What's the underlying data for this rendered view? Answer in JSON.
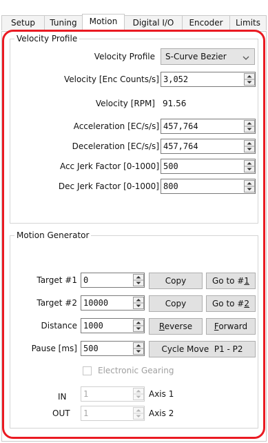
{
  "tabs": [
    {
      "label": "Setup"
    },
    {
      "label": "Tuning"
    },
    {
      "label": "Motion",
      "active": true
    },
    {
      "label": "Digital I/O"
    },
    {
      "label": "Encoder"
    },
    {
      "label": "Limits"
    }
  ],
  "velocity_profile": {
    "group_title": "Velocity Profile",
    "profile_label": "Velocity Profile",
    "profile_value": "S-Curve Bezier",
    "velocity_label": "Velocity [Enc Counts/s]",
    "velocity_value": "3,052",
    "velocity_rpm_label": "Velocity [RPM]",
    "velocity_rpm_value": "91.56",
    "accel_label": "Acceleration [EC/s/s]",
    "accel_value": "457,764",
    "decel_label": "Deceleration [EC/s/s]",
    "decel_value": "457,764",
    "acc_jerk_label": "Acc Jerk Factor [0-1000]",
    "acc_jerk_value": "500",
    "dec_jerk_label": "Dec Jerk Factor [0-1000]",
    "dec_jerk_value": "800"
  },
  "motion_generator": {
    "group_title": "Motion Generator",
    "target1_label": "Target #1",
    "target1_value": "0",
    "target2_label": "Target #2",
    "target2_value": "10000",
    "distance_label": "Distance",
    "distance_value": "1000",
    "pause_label": "Pause [ms]",
    "pause_value": "500",
    "copy1_label": "Copy",
    "goto1_prefix": "Go to #",
    "goto1_key": "1",
    "copy2_label": "Copy",
    "goto2_prefix": "Go to #",
    "goto2_key": "2",
    "reverse_key": "R",
    "reverse_rest": "everse",
    "forward_key": "F",
    "forward_rest": "orward",
    "cycle_label": "Cycle Move  P1 - P2",
    "gearing_label": "Electronic Gearing",
    "in_label": "IN",
    "in_value": "1",
    "in_axis": "Axis 1",
    "out_label": "OUT",
    "out_value": "1",
    "out_axis": "Axis 2"
  },
  "colors": {
    "highlight": "#ea1a22"
  }
}
